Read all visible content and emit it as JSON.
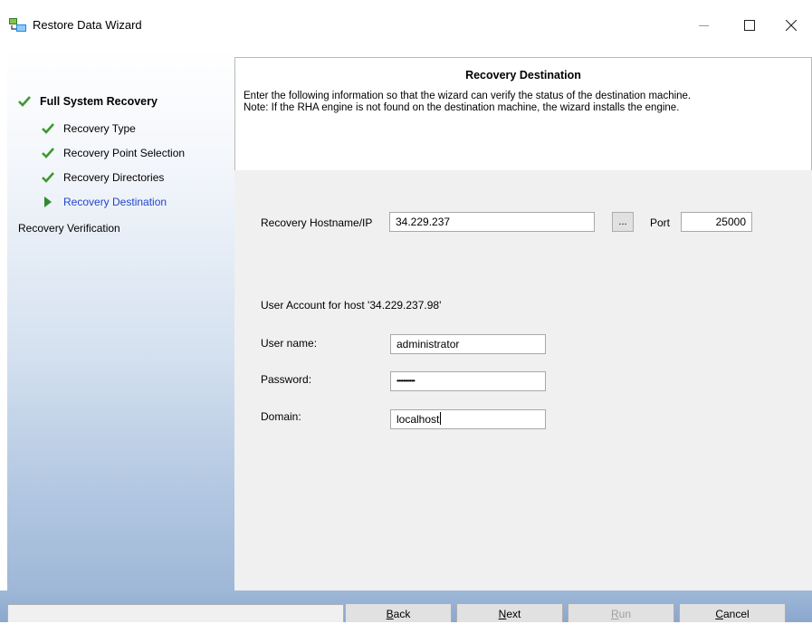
{
  "window": {
    "title": "Restore Data Wizard"
  },
  "sidebar": {
    "main_step": "Full System Recovery",
    "substeps": [
      {
        "label": "Recovery Type",
        "state": "done"
      },
      {
        "label": "Recovery Point Selection",
        "state": "done"
      },
      {
        "label": "Recovery Directories",
        "state": "done"
      },
      {
        "label": "Recovery Destination",
        "state": "current"
      }
    ],
    "pending_step": "Recovery Verification"
  },
  "header": {
    "title": "Recovery Destination",
    "line1": "Enter the following information so that the wizard can verify the status of the destination machine.",
    "line2": "Note: If the RHA engine is not found on the destination machine, the wizard installs the engine."
  },
  "form": {
    "hostname_label": "Recovery Hostname/IP",
    "hostname_value": "34.229.237",
    "browse_label": "...",
    "port_label": "Port",
    "port_value": "25000",
    "account_heading": "User Account for host '34.229.237.98'",
    "username_label": "User name:",
    "username_value": "administrator",
    "password_label": "Password:",
    "password_value": "•••••••••••",
    "domain_label": "Domain:",
    "domain_value": "localhost"
  },
  "buttons": {
    "back": {
      "first": "B",
      "rest": "ack"
    },
    "next": {
      "first": "N",
      "rest": "ext"
    },
    "run": {
      "first": "R",
      "rest": "un"
    },
    "cancel": {
      "first": "C",
      "rest": "ancel"
    }
  },
  "colors": {
    "check_green": "#3c9a2e",
    "active_blue": "#2244cc",
    "arrow_green": "#2e8b2e"
  }
}
